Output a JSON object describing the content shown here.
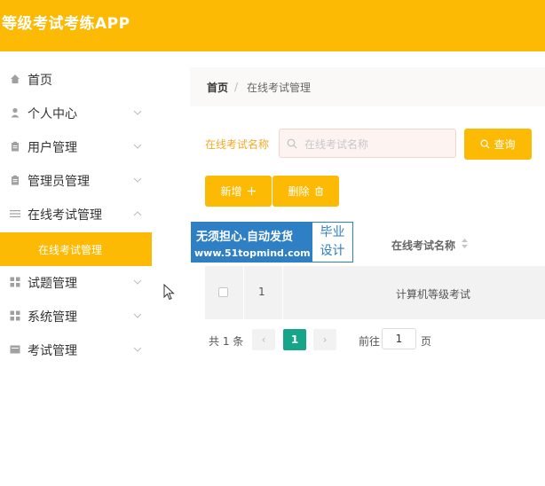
{
  "header": {
    "title": "等级考试考练APP"
  },
  "sidebar": {
    "items": [
      {
        "label": "首页",
        "icon": "home-icon"
      },
      {
        "label": "个人中心",
        "icon": "user-icon"
      },
      {
        "label": "用户管理",
        "icon": "clipboard-icon"
      },
      {
        "label": "管理员管理",
        "icon": "clipboard-icon"
      },
      {
        "label": "在线考试管理",
        "icon": "menu-lines-icon"
      },
      {
        "label": "试题管理",
        "icon": "grid-icon"
      },
      {
        "label": "系统管理",
        "icon": "grid-icon"
      },
      {
        "label": "考试管理",
        "icon": "box-icon"
      }
    ],
    "active_sub": "在线考试管理"
  },
  "breadcrumb": {
    "home": "首页",
    "separator": "/",
    "current": "在线考试管理"
  },
  "search": {
    "label": "在线考试名称",
    "placeholder": "在线考试名称",
    "value": "",
    "query_label": "查询"
  },
  "actions": {
    "add_label": "新增",
    "delete_label": "删除"
  },
  "table": {
    "columns": [
      "在线考试名称"
    ],
    "rows": [
      {
        "index": "1",
        "name": "计算机等级考试"
      }
    ]
  },
  "watermark": {
    "line1": "无须担心.自动发货",
    "line2": "www.51topmind.com",
    "box_top": "毕业",
    "box_bottom": "设计"
  },
  "pagination": {
    "total": "共 1 条",
    "current": "1",
    "goto_label": "前往",
    "goto_value": "1",
    "unit": "页",
    "prev_symbol": "‹",
    "next_symbol": "›"
  },
  "colors": {
    "accent": "#fcba05",
    "page_active": "#17a589",
    "watermark": "#2e7fc3"
  }
}
